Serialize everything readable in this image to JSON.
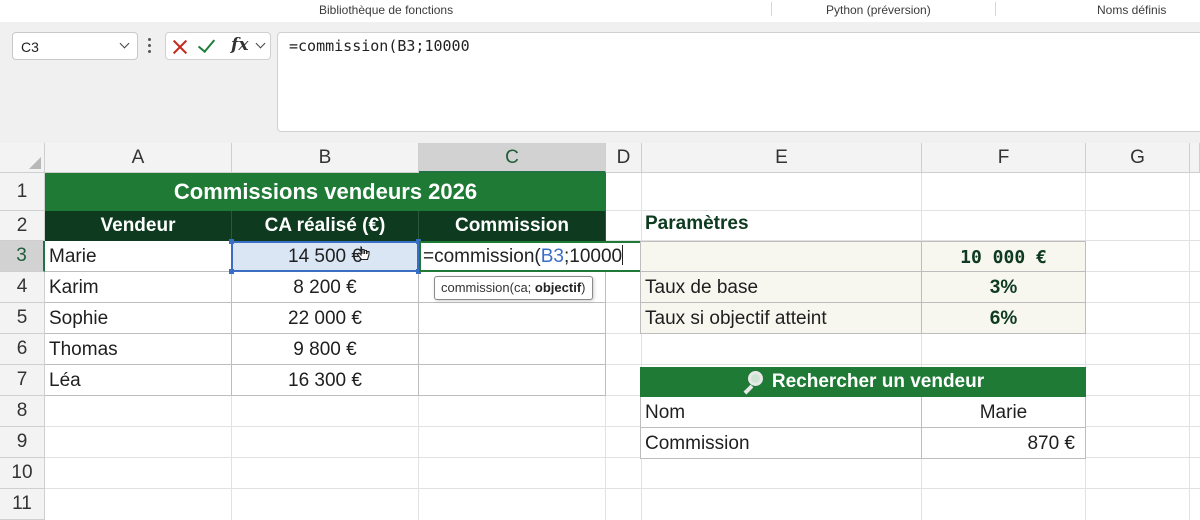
{
  "ribbon": {
    "group1": "Bibliothèque de fonctions",
    "group2": "Python (préversion)",
    "group3": "Noms définis"
  },
  "formula_bar": {
    "name_box": "C3",
    "formula": "=commission(B3;10000"
  },
  "columns": [
    "A",
    "B",
    "C",
    "D",
    "E",
    "F",
    "G"
  ],
  "rows": [
    "1",
    "2",
    "3",
    "4",
    "5",
    "6",
    "7",
    "8",
    "9",
    "10",
    "11"
  ],
  "table": {
    "title": "Commissions vendeurs 2026",
    "headers": [
      "Vendeur",
      "CA réalisé (€)",
      "Commission"
    ],
    "rows": [
      {
        "vendeur": "Marie",
        "ca": "14 500 €"
      },
      {
        "vendeur": "Karim",
        "ca": "8 200 €"
      },
      {
        "vendeur": "Sophie",
        "ca": "22 000 €"
      },
      {
        "vendeur": "Thomas",
        "ca": "9 800 €"
      },
      {
        "vendeur": "Léa",
        "ca": "16 300 €"
      }
    ]
  },
  "editing": {
    "prefix": "=commission(",
    "ref": "B3",
    "suffix": ";10000",
    "tooltip_fn": "commission(ca; ",
    "tooltip_arg": "objectif",
    "tooltip_end": ")"
  },
  "params": {
    "title": "Paramètres",
    "objective_value": "10 000 €",
    "base_rate_label": "Taux de base",
    "base_rate_value": "3%",
    "target_rate_label": "Taux si objectif atteint",
    "target_rate_value": "6%"
  },
  "search": {
    "title": "Rechercher un vendeur",
    "name_label": "Nom",
    "name_value": "Marie",
    "commission_label": "Commission",
    "commission_value": "870 €"
  },
  "colors": {
    "accent_green": "#1e7a34",
    "dark_green": "#0e3a1f",
    "selection_blue": "#3a6ec5"
  }
}
